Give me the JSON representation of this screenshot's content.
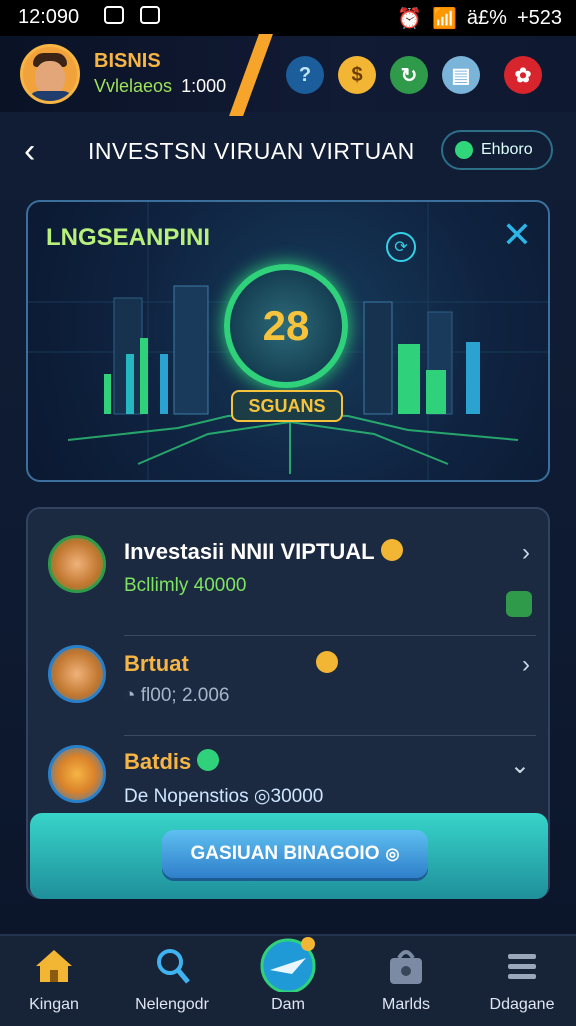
{
  "status_bar": {
    "time": "12:090",
    "right_text": "ä£%",
    "battery": "+523"
  },
  "top_bar": {
    "brand": "BISNIS",
    "subtitle": "Vvlelaeos",
    "balance": "1:000"
  },
  "header": {
    "title": "INVESTSN VIRUAN VIRTUAN",
    "chip_label": "Ehboro"
  },
  "hero": {
    "title": "LNGSEANPINI",
    "value": "28",
    "badge": "SGUANS",
    "bar_colors": [
      "#2fd17a",
      "#26b8c0",
      "#2aa3d0"
    ]
  },
  "list": [
    {
      "name": "Investasii NNII VIPTUAL",
      "name_highlight": "VIPTUAL",
      "detail": "Bcllimly 40000",
      "icon": "monkey-avatar-icon"
    },
    {
      "name": "Brtuat",
      "detail": "fl00; 2.006",
      "icon": "boy-avatar-icon"
    },
    {
      "name": "Batdis",
      "detail": "De Nopenstios",
      "detail_value": "30000",
      "icon": "city-avatar-icon"
    }
  ],
  "cta": {
    "label": "GASIUAN BINAGOIO"
  },
  "bottom_nav": [
    {
      "label": "Kingan",
      "icon": "home-icon"
    },
    {
      "label": "Nelengodr",
      "icon": "search-icon"
    },
    {
      "label": "Dam",
      "icon": "plane-icon"
    },
    {
      "label": "Marlds",
      "icon": "bag-icon"
    },
    {
      "label": "Ddagane",
      "icon": "menu-icon"
    }
  ]
}
